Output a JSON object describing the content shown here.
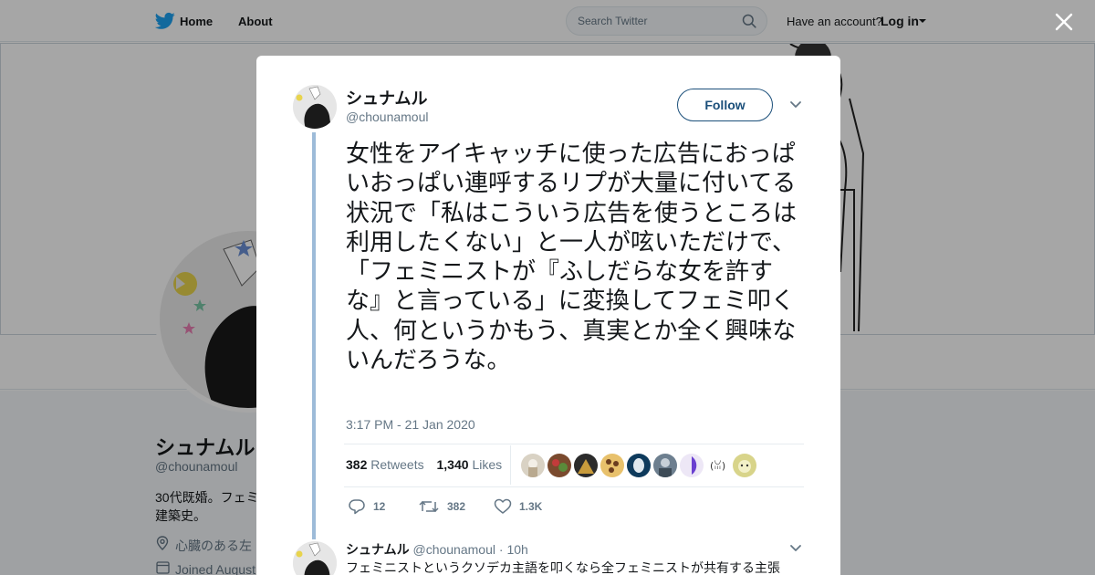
{
  "nav": {
    "home_label": "Home",
    "about_label": "About",
    "search_placeholder": "Search Twitter",
    "have_account": "Have an account?",
    "login_label": "Log in"
  },
  "profile": {
    "name": "シュナムル",
    "handle": "@chounamoul",
    "bio_line1": "30代既婚。フェミ",
    "bio_line2": "建築史。",
    "location": "心臓のある左",
    "joined": "Joined August"
  },
  "tweet": {
    "author_name": "シュナムル",
    "author_handle": "@chounamoul",
    "follow_label": "Follow",
    "text": "女性をアイキャッチに使った広告におっぱいおっぱい連呼するリプが大量に付いてる状況で「私はこういう広告を使うところは利用したくない」と一人が呟いただけで、「フェミニストが『ふしだらな女を許すな』と言っている」に変換してフェミ叩く人、何というかもう、真実とか全く興味ないんだろうな。",
    "timestamp": "3:17 PM - 21 Jan 2020",
    "retweets_count": "382",
    "retweets_label": "Retweets",
    "likes_count": "1,340",
    "likes_label": "Likes",
    "replies_action_count": "12",
    "retweets_action_count": "382",
    "likes_action_count": "1.3K"
  },
  "reply": {
    "name": "シュナムル",
    "handle": "@chounamoul",
    "age": "10h",
    "text": "フェミニストというクソデカ主語を叩くなら全フェミニストが共有する主張"
  },
  "colors": {
    "twitter_blue": "#1da1f2",
    "follow_border": "#1b4f7a",
    "thread_line": "#9dbbd8",
    "muted_text": "#657786"
  }
}
